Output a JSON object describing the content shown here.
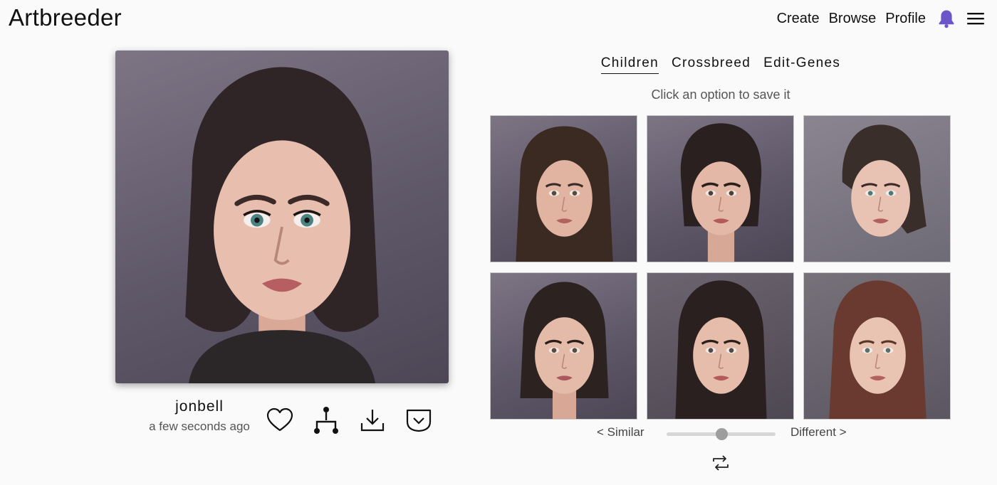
{
  "header": {
    "logo": "Artbreeder",
    "nav": [
      "Create",
      "Browse",
      "Profile"
    ],
    "notification_icon": "bell-icon",
    "menu_icon": "hamburger-menu-icon"
  },
  "main_image": {
    "author": "jonbell",
    "timestamp": "a few seconds ago",
    "actions": [
      "heart-icon",
      "family-tree-icon",
      "download-icon",
      "dropdown-chevron-icon"
    ]
  },
  "panel": {
    "tabs": [
      {
        "label": "Children",
        "active": true
      },
      {
        "label": "Crossbreed",
        "active": false
      },
      {
        "label": "Edit-Genes",
        "active": false
      }
    ],
    "hint": "Click an option to save it",
    "children_count": 6,
    "slider": {
      "left_label": "< Similar",
      "right_label": "Different >",
      "value": 0.5
    },
    "refresh_icon": "refresh-icon"
  },
  "colors": {
    "accent": "#6b55c9",
    "background": "#fafafa",
    "text": "#111111",
    "muted_text": "#555555",
    "slider_track": "#d6d6d6",
    "slider_thumb": "#9e9e9e"
  }
}
